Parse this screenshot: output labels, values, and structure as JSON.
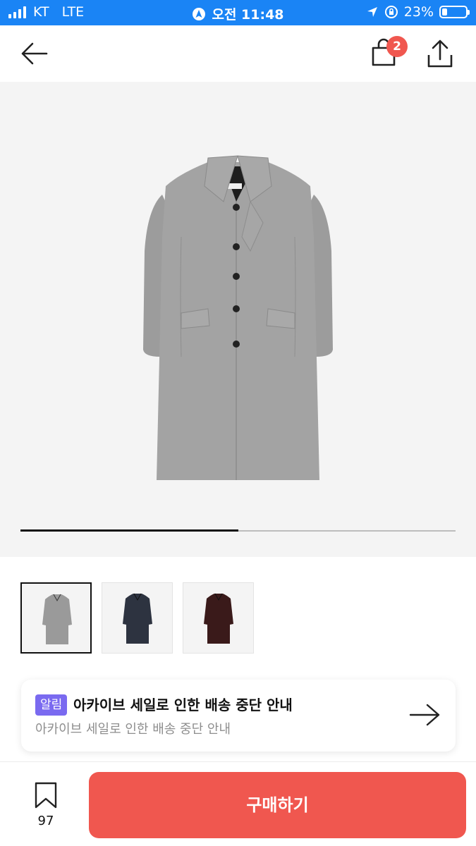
{
  "status_bar": {
    "carrier": "KT",
    "network": "LTE",
    "time": "오전 11:48",
    "battery_percent": "23%",
    "battery_level": 0.23,
    "bg_color": "#1a84f5"
  },
  "nav": {
    "cart_badge": "2",
    "icons": [
      "back-arrow-icon",
      "shopping-bag-icon",
      "share-icon"
    ]
  },
  "gallery": {
    "progress": 0.5,
    "thumbnails": [
      {
        "color_name": "gray",
        "coat_color": "#9a9a9a",
        "selected": true
      },
      {
        "color_name": "navy",
        "coat_color": "#2d3340",
        "selected": false
      },
      {
        "color_name": "burgundy",
        "coat_color": "#3a1a1a",
        "selected": false
      }
    ]
  },
  "notice": {
    "tag": "알림",
    "title": "아카이브 세일로 인한 배송 중단 안내",
    "subtitle": "아카이브 세일로 인한 배송 중단 안내"
  },
  "bottom_bar": {
    "bookmark_count": "97",
    "buy_label": "구매하기",
    "buy_color": "#f0574f"
  }
}
